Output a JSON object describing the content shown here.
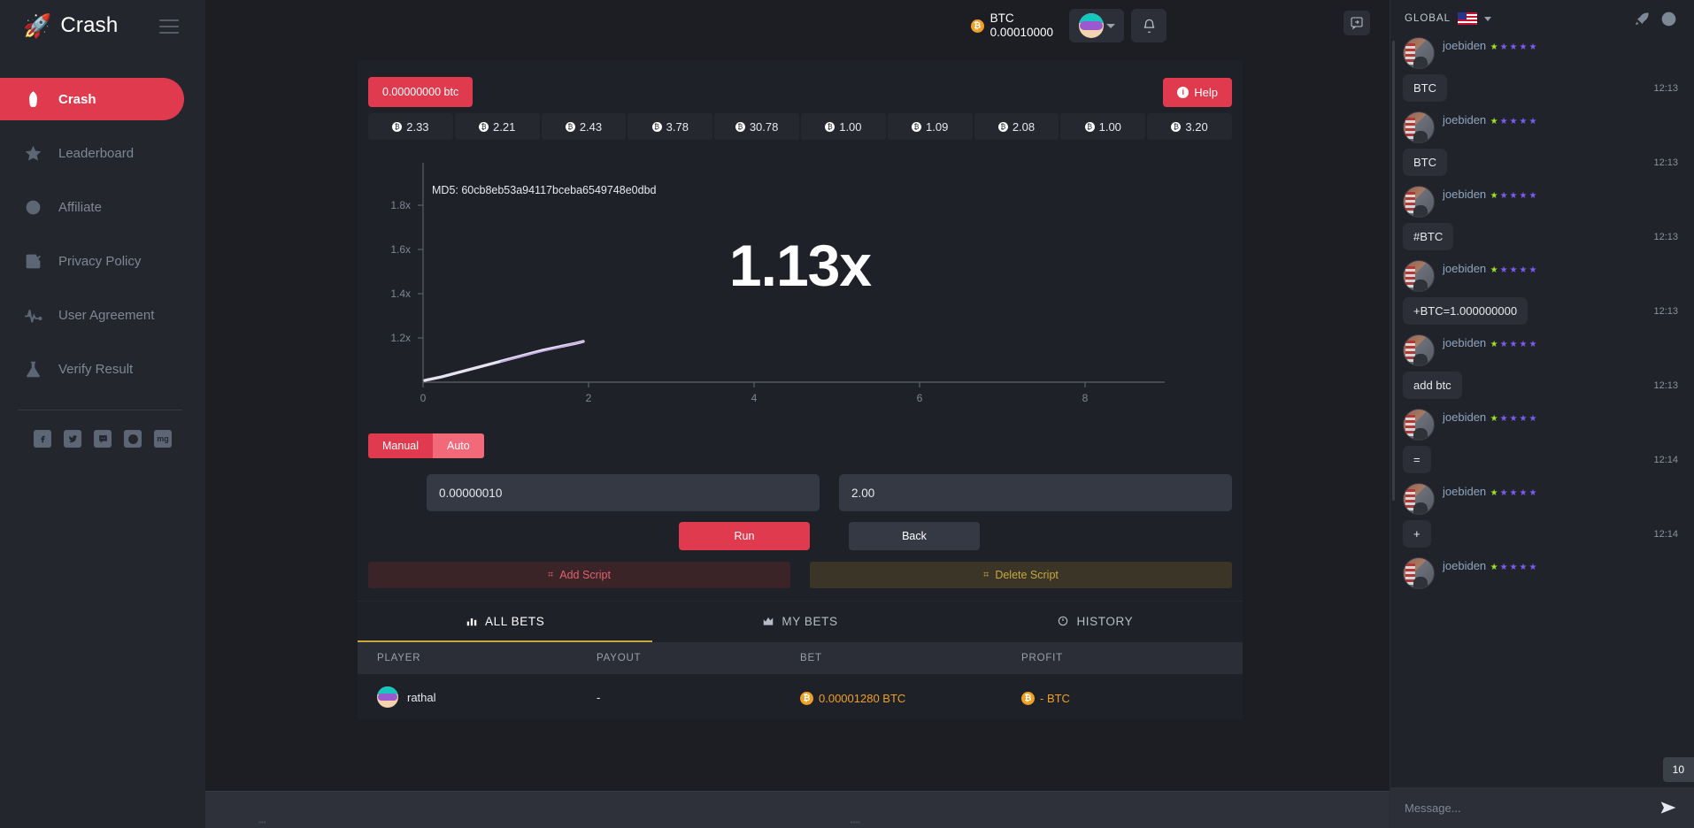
{
  "brand": {
    "name": "Crash",
    "rocket_icon": "rocket-icon"
  },
  "sidebar": {
    "items": [
      {
        "label": "Crash",
        "icon": "rocket-icon",
        "active": true
      },
      {
        "label": "Leaderboard",
        "icon": "star-icon",
        "active": false
      },
      {
        "label": "Affiliate",
        "icon": "target-icon",
        "active": false
      },
      {
        "label": "Privacy Policy",
        "icon": "checkbox-icon",
        "active": false
      },
      {
        "label": "User Agreement",
        "icon": "pulse-icon",
        "active": false
      },
      {
        "label": "Verify Result",
        "icon": "flask-icon",
        "active": false
      }
    ],
    "socials": [
      {
        "name": "facebook-icon",
        "glyph": "f"
      },
      {
        "name": "twitter-icon",
        "glyph": "t"
      },
      {
        "name": "discord-icon",
        "glyph": "d"
      },
      {
        "name": "dribbble-icon",
        "glyph": "b"
      },
      {
        "name": "mg-icon",
        "glyph": "mg"
      }
    ]
  },
  "topbar": {
    "currency": "BTC",
    "balance": "0.00010000",
    "coin_symbol": "₿",
    "avatar_icon": "avatar",
    "chevron_icon": "chevron-down-icon",
    "bell_icon": "bell-icon",
    "collapse_icon": "collapse-panel-icon"
  },
  "game": {
    "bet_badge": "0.00000000 btc",
    "help_label": "Help",
    "history": [
      "2.33",
      "2.21",
      "2.43",
      "3.78",
      "30.78",
      "1.00",
      "1.09",
      "2.08",
      "1.00",
      "3.20"
    ],
    "md5_label": "MD5: 60cb8eb53a94117bceba6549748e0dbd",
    "multiplier": "1.13x",
    "mode": {
      "manual": "Manual",
      "auto": "Auto",
      "selected": "Manual"
    },
    "bet_amount": "0.00000010",
    "cashout_at": "2.00",
    "run_label": "Run",
    "back_label": "Back",
    "add_script_label": "Add Script",
    "delete_script_label": "Delete Script"
  },
  "chart_data": {
    "type": "line",
    "title": "",
    "xlabel": "",
    "ylabel": "",
    "xticks": [
      0,
      2,
      4,
      6,
      8
    ],
    "yticks": [
      "1.2x",
      "1.4x",
      "1.6x",
      "1.8x"
    ],
    "ylim": [
      1.0,
      1.9
    ],
    "xlim": [
      0,
      9
    ],
    "grid": false,
    "annotation": "MD5: 60cb8eb53a94117bceba6549748e0dbd",
    "current_value": "1.13x",
    "series": [
      {
        "name": "multiplier",
        "color": "#e6e3f2",
        "x": [
          0,
          0.2,
          0.4,
          0.6,
          0.8,
          1.0,
          1.2,
          1.4,
          1.6,
          1.8,
          1.9
        ],
        "y": [
          1.0,
          1.014,
          1.028,
          1.043,
          1.057,
          1.072,
          1.086,
          1.1,
          1.112,
          1.125,
          1.13
        ]
      }
    ]
  },
  "tabs": [
    {
      "label": "ALL BETS",
      "icon": "bar-chart-icon",
      "active": true
    },
    {
      "label": "MY BETS",
      "icon": "chart-icon",
      "active": false
    },
    {
      "label": "HISTORY",
      "icon": "clock-icon",
      "active": false
    }
  ],
  "table": {
    "columns": [
      "PLAYER",
      "PAYOUT",
      "BET",
      "PROFIT"
    ],
    "rows": [
      {
        "player": "rathal",
        "payout": "-",
        "bet": "0.00001280 BTC",
        "profit": "- BTC"
      }
    ]
  },
  "chat": {
    "title": "GLOBAL",
    "flag_icon": "us-flag-icon",
    "chevron_icon": "chevron-down-icon",
    "rocket_icon": "rocket-icon",
    "info_icon": "info-icon",
    "unread_count": "10",
    "input_placeholder": "Message...",
    "send_icon": "send-icon",
    "messages": [
      {
        "user": "joebiden",
        "text": "BTC",
        "time": "12:13"
      },
      {
        "user": "joebiden",
        "text": "BTC",
        "time": "12:13"
      },
      {
        "user": "joebiden",
        "text": "#BTC",
        "time": "12:13"
      },
      {
        "user": "joebiden",
        "text": "+BTC=1.000000000",
        "time": "12:13"
      },
      {
        "user": "joebiden",
        "text": "add btc",
        "time": "12:13"
      },
      {
        "user": "joebiden",
        "text": "=",
        "time": "12:14"
      },
      {
        "user": "joebiden",
        "text": "+",
        "time": "12:14"
      },
      {
        "user": "joebiden",
        "text": "",
        "time": ""
      }
    ]
  },
  "colors": {
    "accent_red": "#e03a4e",
    "accent_gold": "#c7a93f",
    "btc_orange": "#f0a024",
    "panel_bg": "#1f2128",
    "sidebar_bg": "#24262d",
    "chat_bg": "#21232a"
  }
}
